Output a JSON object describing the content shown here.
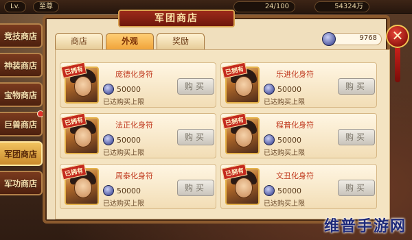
{
  "topbar": {
    "player_level": "Lv.",
    "vip": "至尊",
    "stamina": "24/100",
    "gold": "54324万"
  },
  "sidebar": {
    "items": [
      {
        "label": "竞技商店",
        "active": false,
        "dot": false
      },
      {
        "label": "神装商店",
        "active": false,
        "dot": false
      },
      {
        "label": "宝物商店",
        "active": false,
        "dot": false
      },
      {
        "label": "巨兽商店",
        "active": false,
        "dot": true
      },
      {
        "label": "军团商店",
        "active": true,
        "dot": false
      },
      {
        "label": "军功商店",
        "active": false,
        "dot": false
      }
    ]
  },
  "panel": {
    "title": "军团商店",
    "tabs": [
      {
        "label": "商店",
        "active": false
      },
      {
        "label": "外观",
        "active": true
      },
      {
        "label": "奖励",
        "active": false
      }
    ],
    "currency_value": "9768",
    "close_label": "✕"
  },
  "items": [
    {
      "name": "庞德化身符",
      "price": "50000",
      "limit": "已达购买上限",
      "owned": "已拥有",
      "buy": "购买"
    },
    {
      "name": "乐进化身符",
      "price": "50000",
      "limit": "已达购买上限",
      "owned": "已拥有",
      "buy": "购买"
    },
    {
      "name": "法正化身符",
      "price": "50000",
      "limit": "已达购买上限",
      "owned": "已拥有",
      "buy": "购买"
    },
    {
      "name": "程普化身符",
      "price": "50000",
      "limit": "已达购买上限",
      "owned": "已拥有",
      "buy": "购买"
    },
    {
      "name": "周泰化身符",
      "price": "50000",
      "limit": "已达购买上限",
      "owned": "已拥有",
      "buy": "购买"
    },
    {
      "name": "文丑化身符",
      "price": "50000",
      "limit": "已达购买上限",
      "owned": "已拥有",
      "buy": "购买"
    }
  ],
  "watermark": "维普手游网",
  "colors": {
    "accent_gold": "#f0a43a",
    "item_name_red": "#c0391e",
    "owned_badge_red": "#c42a1e"
  }
}
